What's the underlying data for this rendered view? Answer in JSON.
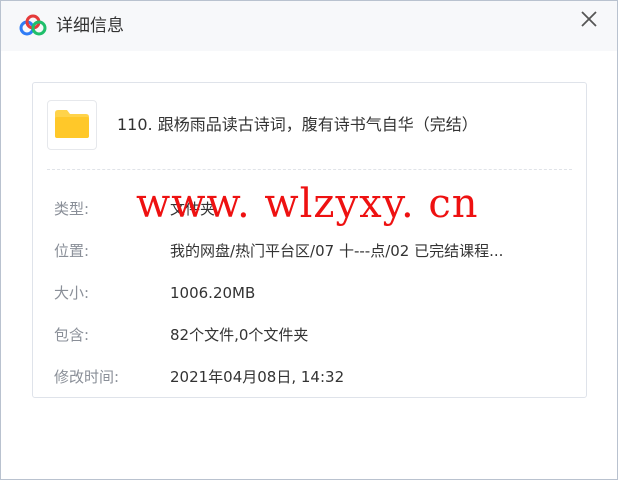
{
  "window": {
    "title": "详细信息",
    "logo_icon": "baidu-netdisk-logo-icon",
    "close_icon": "close-icon"
  },
  "file": {
    "icon": "folder-icon",
    "name": "110. 跟杨雨品读古诗词，腹有诗书气自华（完结）"
  },
  "details": [
    {
      "label": "类型:",
      "value": "文件夹"
    },
    {
      "label": "位置:",
      "value": "我的网盘/热门平台区/07 十---点/02 已完结课程..."
    },
    {
      "label": "大小:",
      "value": "1006.20MB"
    },
    {
      "label": "包含:",
      "value": "82个文件,0个文件夹"
    },
    {
      "label": "修改时间:",
      "value": "2021年04月08日, 14:32"
    }
  ],
  "watermark": "www. wlzyxy. cn",
  "colors": {
    "titlebar_bg": "#f7f8fa",
    "label": "#8a8f98",
    "value": "#333333",
    "folder": "#ffd34a",
    "watermark": "#ee1111"
  }
}
